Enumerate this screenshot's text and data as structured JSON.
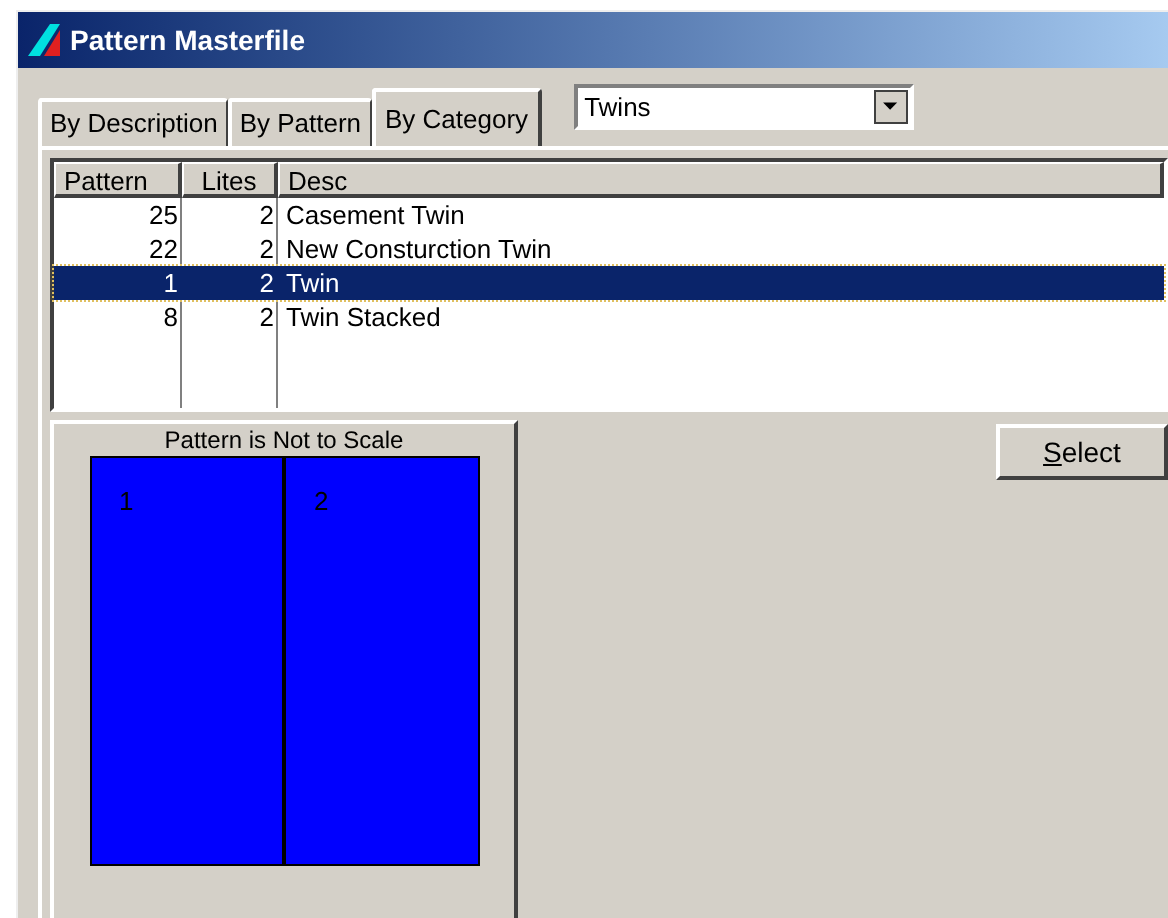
{
  "window": {
    "title": "Pattern Masterfile"
  },
  "tabs": [
    {
      "label": "By Description",
      "selected": false
    },
    {
      "label": "By Pattern",
      "selected": false
    },
    {
      "label": "By Category",
      "selected": true
    }
  ],
  "category_dropdown": {
    "value": "Twins"
  },
  "table": {
    "columns": [
      "Pattern",
      "Lites",
      "Desc"
    ],
    "rows": [
      {
        "pattern": "25",
        "lites": "2",
        "desc": "Casement Twin",
        "selected": false
      },
      {
        "pattern": "22",
        "lites": "2",
        "desc": "New Consturction Twin",
        "selected": false
      },
      {
        "pattern": "1",
        "lites": "2",
        "desc": "Twin",
        "selected": true
      },
      {
        "pattern": "8",
        "lites": "2",
        "desc": "Twin Stacked",
        "selected": false
      }
    ]
  },
  "preview": {
    "caption": "Pattern is Not to Scale",
    "lites": [
      {
        "label": "1"
      },
      {
        "label": "2"
      }
    ]
  },
  "buttons": [
    {
      "label": "Select"
    }
  ]
}
